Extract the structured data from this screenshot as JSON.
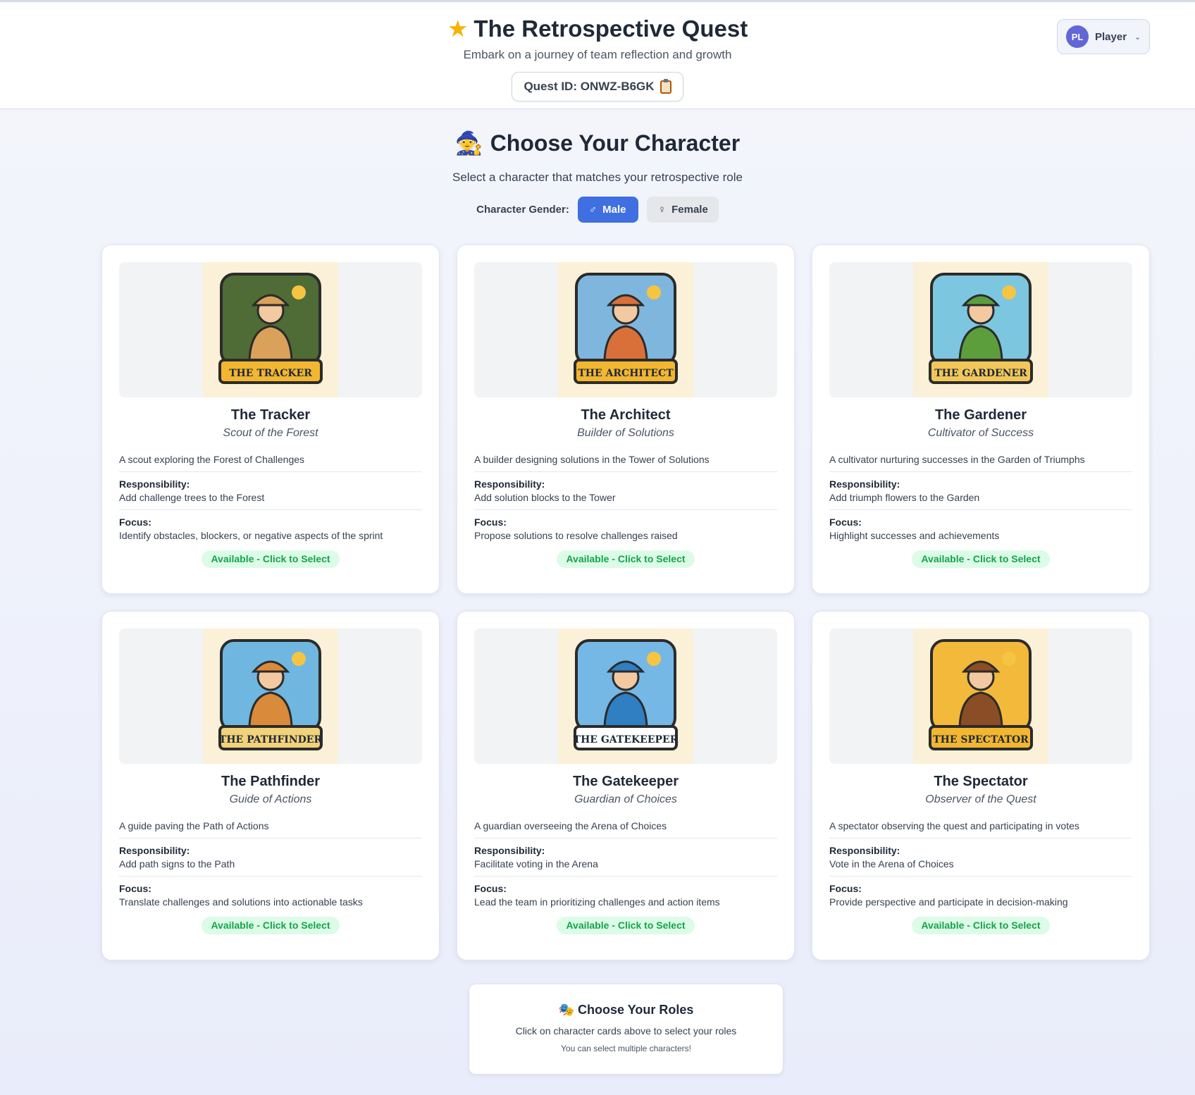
{
  "header": {
    "title": "The Retrospective Quest",
    "subtitle": "Embark on a journey of team reflection and growth",
    "quest_id": "Quest ID: ONWZ-B6GK"
  },
  "player": {
    "initials": "PL",
    "name": "Player"
  },
  "section": {
    "title": "Choose Your Character",
    "subtitle": "Select a character that matches your retrospective role",
    "gender_label": "Character Gender:",
    "gender_options": [
      {
        "symbol": "♂",
        "label": "Male",
        "selected": true
      },
      {
        "symbol": "♀",
        "label": "Female",
        "selected": false
      }
    ]
  },
  "labels": {
    "responsibility": "Responsibility:",
    "focus": "Focus:"
  },
  "characters": [
    {
      "name": "The Tracker",
      "role": "Scout of the Forest",
      "banner": "THE TRACKER",
      "description": "A scout exploring the Forest of Challenges",
      "responsibility": "Add challenge trees to the Forest",
      "focus": "Identify obstacles, blockers, or negative aspects of the sprint",
      "status": "Available - Click to Select",
      "colors": {
        "bg": "#4f6b36",
        "banner": "#f2b631",
        "accent": "#d9a15a"
      }
    },
    {
      "name": "The Architect",
      "role": "Builder of Solutions",
      "banner": "THE ARCHITECT",
      "description": "A builder designing solutions in the Tower of Solutions",
      "responsibility": "Add solution blocks to the Tower",
      "focus": "Propose solutions to resolve challenges raised",
      "status": "Available - Click to Select",
      "colors": {
        "bg": "#7fb6de",
        "banner": "#f2b631",
        "accent": "#d9703a"
      }
    },
    {
      "name": "The Gardener",
      "role": "Cultivator of Success",
      "banner": "THE GARDENER",
      "description": "A cultivator nurturing successes in the Garden of Triumphs",
      "responsibility": "Add triumph flowers to the Garden",
      "focus": "Highlight successes and achievements",
      "status": "Available - Click to Select",
      "colors": {
        "bg": "#7cc6e0",
        "banner": "#f2c75a",
        "accent": "#5c9e3c"
      }
    },
    {
      "name": "The Pathfinder",
      "role": "Guide of Actions",
      "banner": "THE PATHFINDER",
      "description": "A guide paving the Path of Actions",
      "responsibility": "Add path signs to the Path",
      "focus": "Translate challenges and solutions into actionable tasks",
      "status": "Available - Click to Select",
      "colors": {
        "bg": "#6fb7e0",
        "banner": "#f2d27a",
        "accent": "#d98a3a"
      }
    },
    {
      "name": "The Gatekeeper",
      "role": "Guardian of Choices",
      "banner": "THE GATEKEEPER",
      "description": "A guardian overseeing the Arena of Choices",
      "responsibility": "Facilitate voting in the Arena",
      "focus": "Lead the team in prioritizing challenges and action items",
      "status": "Available - Click to Select",
      "colors": {
        "bg": "#75b8e6",
        "banner": "#ffffff",
        "accent": "#2f7fc2"
      }
    },
    {
      "name": "The Spectator",
      "role": "Observer of the Quest",
      "banner": "THE SPECTATOR",
      "description": "A spectator observing the quest and participating in votes",
      "responsibility": "Vote in the Arena of Choices",
      "focus": "Provide perspective and participate in decision-making",
      "status": "Available - Click to Select",
      "colors": {
        "bg": "#f3b93b",
        "banner": "#f2b631",
        "accent": "#8a4d25"
      }
    }
  ],
  "roles_box": {
    "title": "Choose Your Roles",
    "text": "Click on character cards above to select your roles",
    "hint": "You can select multiple characters!"
  }
}
